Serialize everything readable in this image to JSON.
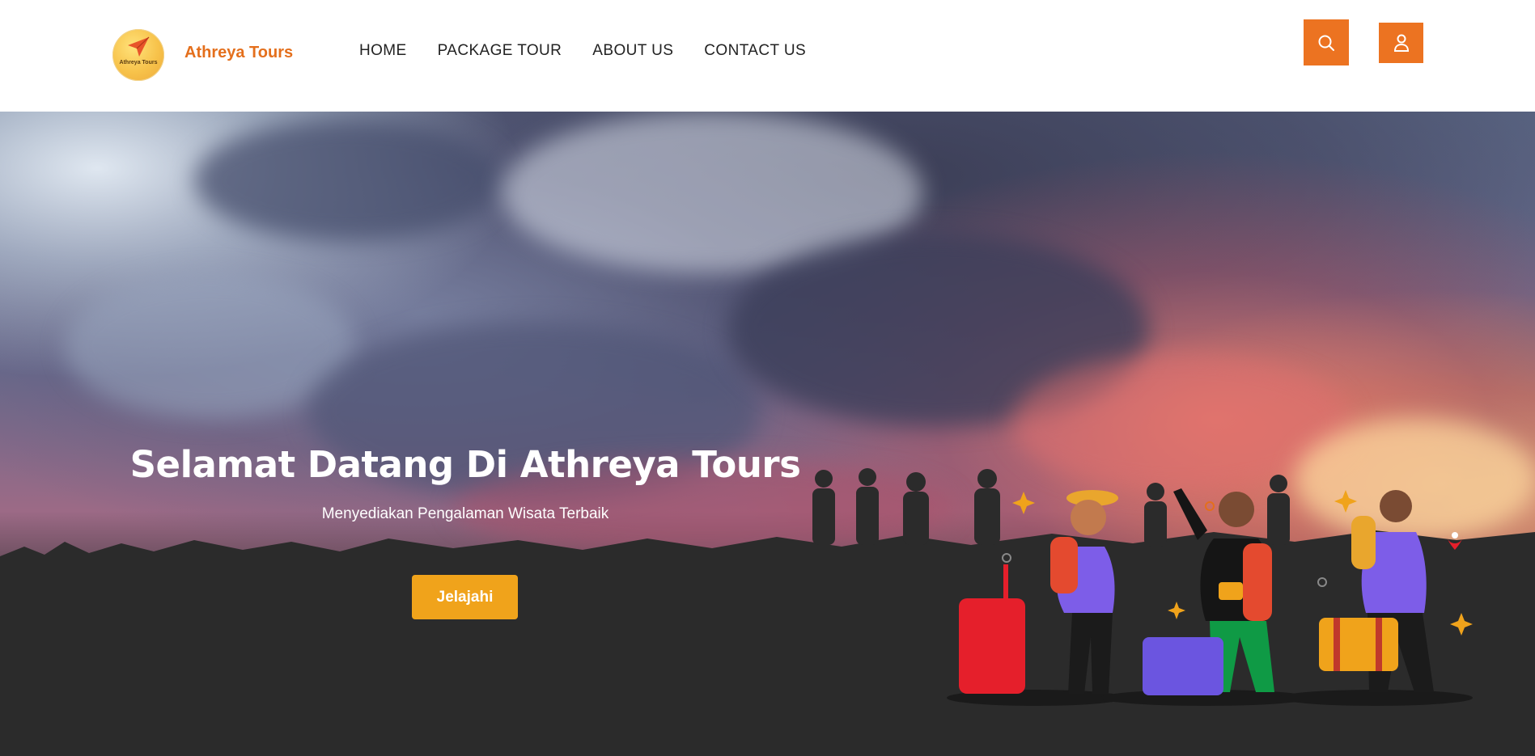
{
  "header": {
    "brand_name": "Athreya Tours",
    "logo_text": "Athreya Tours",
    "nav": [
      {
        "label": "HOME"
      },
      {
        "label": "PACKAGE TOUR"
      },
      {
        "label": "ABOUT US"
      },
      {
        "label": "CONTACT US"
      }
    ],
    "search_icon": "search-icon",
    "user_icon": "user-icon"
  },
  "hero": {
    "title": "Selamat Datang Di Athreya Tours",
    "subtitle": "Menyediakan Pengalaman Wisata Terbaik",
    "cta_label": "Jelajahi"
  },
  "colors": {
    "brand_orange": "#ec7321",
    "cta_yellow": "#f0a31b",
    "brand_text": "#e46f1c"
  }
}
